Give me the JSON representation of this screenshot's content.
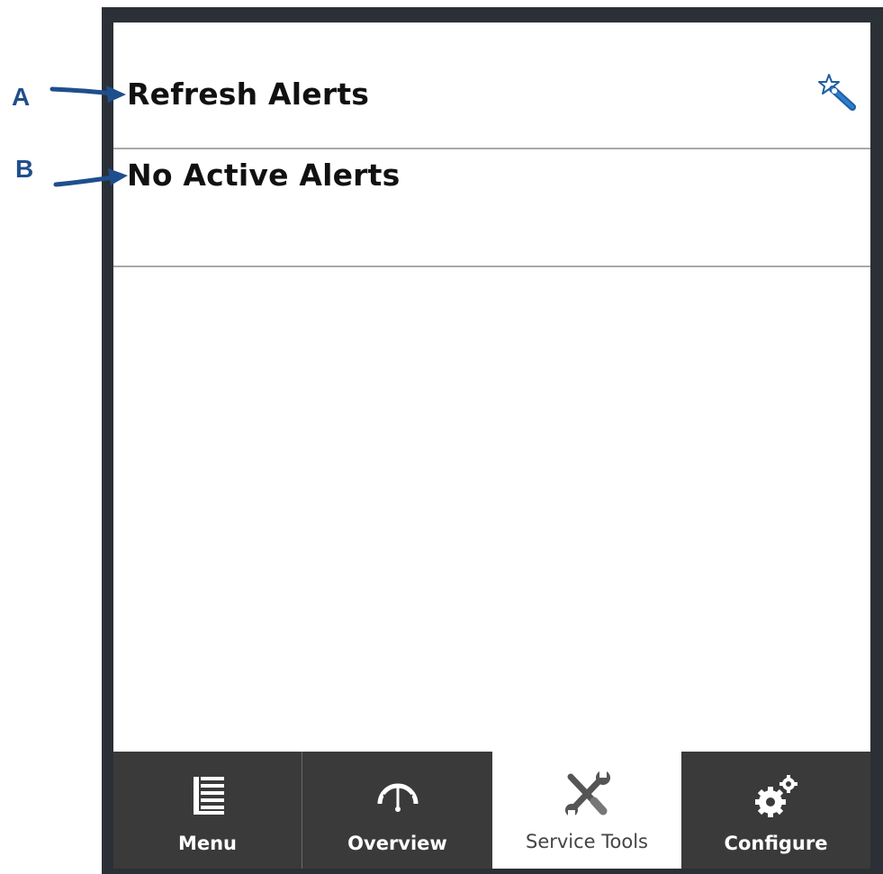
{
  "callouts": {
    "a": "A",
    "b": "B"
  },
  "list": {
    "refresh_label": "Refresh Alerts",
    "refresh_icon": "magic-wand-icon",
    "status_label": "No Active Alerts"
  },
  "tabs": [
    {
      "label": "Menu",
      "icon": "list-icon",
      "active": false
    },
    {
      "label": "Overview",
      "icon": "gauge-icon",
      "active": false
    },
    {
      "label": "Service Tools",
      "icon": "tools-icon",
      "active": true
    },
    {
      "label": "Configure",
      "icon": "gears-icon",
      "active": false
    }
  ],
  "colors": {
    "bezel": "#2b3036",
    "tabbar": "#3a3a3a",
    "callout": "#1f4e8c"
  }
}
